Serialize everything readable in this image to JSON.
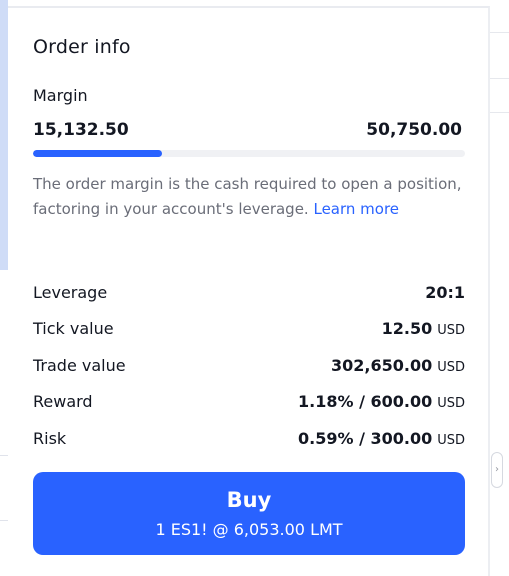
{
  "panel": {
    "title": "Order info"
  },
  "margin": {
    "label": "Margin",
    "used": "15,132.50",
    "available": "50,750.00",
    "progress_fraction": 0.298,
    "description": "The order margin is the cash required to open a position, factoring in your account's leverage.",
    "learn_more_label": "Learn more"
  },
  "details": [
    {
      "label": "Leverage",
      "value": "20:1",
      "unit": ""
    },
    {
      "label": "Tick value",
      "value": "12.50",
      "unit": "USD"
    },
    {
      "label": "Trade value",
      "value": "302,650.00",
      "unit": "USD"
    },
    {
      "label": "Reward",
      "value": "1.18% / 600.00",
      "unit": "USD"
    },
    {
      "label": "Risk",
      "value": "0.59% / 300.00",
      "unit": "USD"
    }
  ],
  "buy_button": {
    "label": "Buy",
    "order_summary": "1 ES1! @ 6,053.00 LMT"
  },
  "colors": {
    "accent": "#2962ff",
    "text": "#131722",
    "muted": "#6a6d78"
  },
  "icons": {
    "collapse_handle": "chevron-right-icon"
  }
}
